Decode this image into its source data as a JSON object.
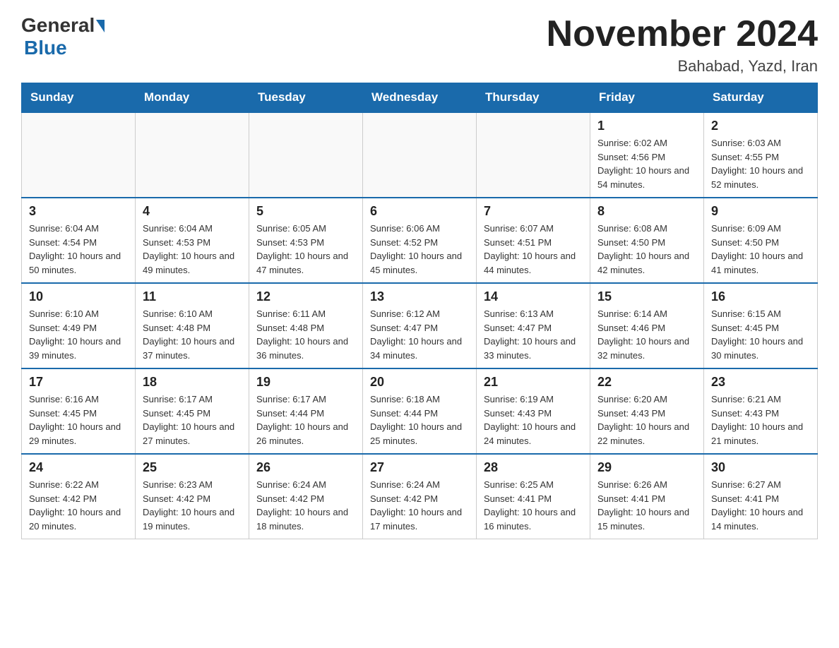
{
  "header": {
    "logo_general": "General",
    "logo_blue": "Blue",
    "month_title": "November 2024",
    "location": "Bahabad, Yazd, Iran"
  },
  "weekdays": [
    "Sunday",
    "Monday",
    "Tuesday",
    "Wednesday",
    "Thursday",
    "Friday",
    "Saturday"
  ],
  "weeks": [
    [
      {
        "day": "",
        "sunrise": "",
        "sunset": "",
        "daylight": ""
      },
      {
        "day": "",
        "sunrise": "",
        "sunset": "",
        "daylight": ""
      },
      {
        "day": "",
        "sunrise": "",
        "sunset": "",
        "daylight": ""
      },
      {
        "day": "",
        "sunrise": "",
        "sunset": "",
        "daylight": ""
      },
      {
        "day": "",
        "sunrise": "",
        "sunset": "",
        "daylight": ""
      },
      {
        "day": "1",
        "sunrise": "Sunrise: 6:02 AM",
        "sunset": "Sunset: 4:56 PM",
        "daylight": "Daylight: 10 hours and 54 minutes."
      },
      {
        "day": "2",
        "sunrise": "Sunrise: 6:03 AM",
        "sunset": "Sunset: 4:55 PM",
        "daylight": "Daylight: 10 hours and 52 minutes."
      }
    ],
    [
      {
        "day": "3",
        "sunrise": "Sunrise: 6:04 AM",
        "sunset": "Sunset: 4:54 PM",
        "daylight": "Daylight: 10 hours and 50 minutes."
      },
      {
        "day": "4",
        "sunrise": "Sunrise: 6:04 AM",
        "sunset": "Sunset: 4:53 PM",
        "daylight": "Daylight: 10 hours and 49 minutes."
      },
      {
        "day": "5",
        "sunrise": "Sunrise: 6:05 AM",
        "sunset": "Sunset: 4:53 PM",
        "daylight": "Daylight: 10 hours and 47 minutes."
      },
      {
        "day": "6",
        "sunrise": "Sunrise: 6:06 AM",
        "sunset": "Sunset: 4:52 PM",
        "daylight": "Daylight: 10 hours and 45 minutes."
      },
      {
        "day": "7",
        "sunrise": "Sunrise: 6:07 AM",
        "sunset": "Sunset: 4:51 PM",
        "daylight": "Daylight: 10 hours and 44 minutes."
      },
      {
        "day": "8",
        "sunrise": "Sunrise: 6:08 AM",
        "sunset": "Sunset: 4:50 PM",
        "daylight": "Daylight: 10 hours and 42 minutes."
      },
      {
        "day": "9",
        "sunrise": "Sunrise: 6:09 AM",
        "sunset": "Sunset: 4:50 PM",
        "daylight": "Daylight: 10 hours and 41 minutes."
      }
    ],
    [
      {
        "day": "10",
        "sunrise": "Sunrise: 6:10 AM",
        "sunset": "Sunset: 4:49 PM",
        "daylight": "Daylight: 10 hours and 39 minutes."
      },
      {
        "day": "11",
        "sunrise": "Sunrise: 6:10 AM",
        "sunset": "Sunset: 4:48 PM",
        "daylight": "Daylight: 10 hours and 37 minutes."
      },
      {
        "day": "12",
        "sunrise": "Sunrise: 6:11 AM",
        "sunset": "Sunset: 4:48 PM",
        "daylight": "Daylight: 10 hours and 36 minutes."
      },
      {
        "day": "13",
        "sunrise": "Sunrise: 6:12 AM",
        "sunset": "Sunset: 4:47 PM",
        "daylight": "Daylight: 10 hours and 34 minutes."
      },
      {
        "day": "14",
        "sunrise": "Sunrise: 6:13 AM",
        "sunset": "Sunset: 4:47 PM",
        "daylight": "Daylight: 10 hours and 33 minutes."
      },
      {
        "day": "15",
        "sunrise": "Sunrise: 6:14 AM",
        "sunset": "Sunset: 4:46 PM",
        "daylight": "Daylight: 10 hours and 32 minutes."
      },
      {
        "day": "16",
        "sunrise": "Sunrise: 6:15 AM",
        "sunset": "Sunset: 4:45 PM",
        "daylight": "Daylight: 10 hours and 30 minutes."
      }
    ],
    [
      {
        "day": "17",
        "sunrise": "Sunrise: 6:16 AM",
        "sunset": "Sunset: 4:45 PM",
        "daylight": "Daylight: 10 hours and 29 minutes."
      },
      {
        "day": "18",
        "sunrise": "Sunrise: 6:17 AM",
        "sunset": "Sunset: 4:45 PM",
        "daylight": "Daylight: 10 hours and 27 minutes."
      },
      {
        "day": "19",
        "sunrise": "Sunrise: 6:17 AM",
        "sunset": "Sunset: 4:44 PM",
        "daylight": "Daylight: 10 hours and 26 minutes."
      },
      {
        "day": "20",
        "sunrise": "Sunrise: 6:18 AM",
        "sunset": "Sunset: 4:44 PM",
        "daylight": "Daylight: 10 hours and 25 minutes."
      },
      {
        "day": "21",
        "sunrise": "Sunrise: 6:19 AM",
        "sunset": "Sunset: 4:43 PM",
        "daylight": "Daylight: 10 hours and 24 minutes."
      },
      {
        "day": "22",
        "sunrise": "Sunrise: 6:20 AM",
        "sunset": "Sunset: 4:43 PM",
        "daylight": "Daylight: 10 hours and 22 minutes."
      },
      {
        "day": "23",
        "sunrise": "Sunrise: 6:21 AM",
        "sunset": "Sunset: 4:43 PM",
        "daylight": "Daylight: 10 hours and 21 minutes."
      }
    ],
    [
      {
        "day": "24",
        "sunrise": "Sunrise: 6:22 AM",
        "sunset": "Sunset: 4:42 PM",
        "daylight": "Daylight: 10 hours and 20 minutes."
      },
      {
        "day": "25",
        "sunrise": "Sunrise: 6:23 AM",
        "sunset": "Sunset: 4:42 PM",
        "daylight": "Daylight: 10 hours and 19 minutes."
      },
      {
        "day": "26",
        "sunrise": "Sunrise: 6:24 AM",
        "sunset": "Sunset: 4:42 PM",
        "daylight": "Daylight: 10 hours and 18 minutes."
      },
      {
        "day": "27",
        "sunrise": "Sunrise: 6:24 AM",
        "sunset": "Sunset: 4:42 PM",
        "daylight": "Daylight: 10 hours and 17 minutes."
      },
      {
        "day": "28",
        "sunrise": "Sunrise: 6:25 AM",
        "sunset": "Sunset: 4:41 PM",
        "daylight": "Daylight: 10 hours and 16 minutes."
      },
      {
        "day": "29",
        "sunrise": "Sunrise: 6:26 AM",
        "sunset": "Sunset: 4:41 PM",
        "daylight": "Daylight: 10 hours and 15 minutes."
      },
      {
        "day": "30",
        "sunrise": "Sunrise: 6:27 AM",
        "sunset": "Sunset: 4:41 PM",
        "daylight": "Daylight: 10 hours and 14 minutes."
      }
    ]
  ]
}
